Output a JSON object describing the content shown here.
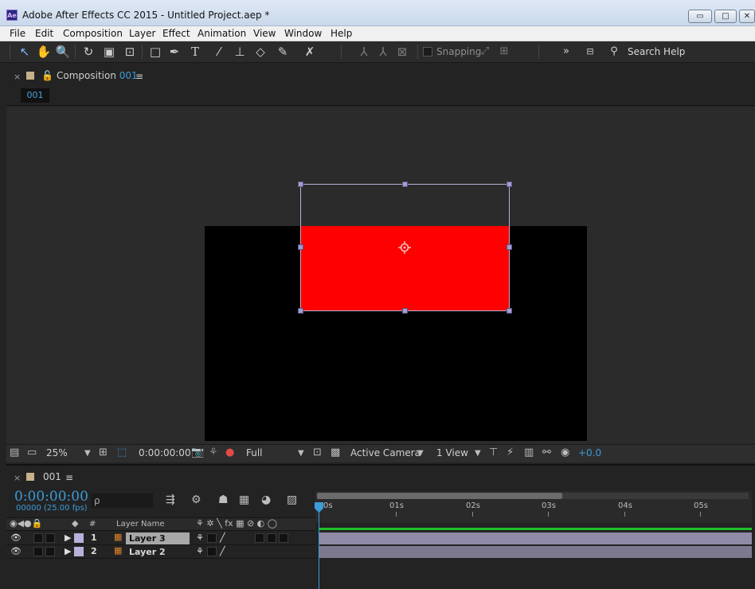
{
  "window": {
    "app_icon_text": "Ae",
    "title": "Adobe After Effects CC 2015 - Untitled Project.aep *",
    "controls": {
      "minimize": "▭",
      "maximize": "□",
      "close": "✕"
    }
  },
  "menu": [
    "File",
    "Edit",
    "Composition",
    "Layer",
    "Effect",
    "Animation",
    "View",
    "Window",
    "Help"
  ],
  "toolbar": {
    "tools": [
      "selection-icon",
      "hand-icon",
      "zoom-icon",
      "rotate-icon",
      "camera-icon",
      "pan-behind-icon",
      "rectangle-icon",
      "pen-icon",
      "type-icon",
      "brush-icon",
      "clone-stamp-icon",
      "eraser-icon",
      "roto-brush-icon",
      "puppet-pin-icon"
    ],
    "snapping_label": "Snapping",
    "search_label": "Search Help",
    "overflow": "»"
  },
  "composition_panel": {
    "close": "×",
    "title_prefix": "Composition",
    "title_number": "001",
    "menu": "≡",
    "tab": "001",
    "footer": {
      "zoom": "25%",
      "timecode": "0:00:00:00",
      "resolution": "Full",
      "camera": "Active Camera",
      "views": "1 View",
      "exposure": "+0.0"
    }
  },
  "timeline": {
    "close": "×",
    "tab": "001",
    "menu": "≡",
    "timecode": "0:00:00:00",
    "fps": "00000 (25.00 fps)",
    "search_placeholder": "ρ",
    "column_layer_name": "Layer Name",
    "column_hash": "#",
    "ruler_labels": [
      "0s",
      "01s",
      "02s",
      "03s",
      "04s",
      "05s"
    ],
    "layers": [
      {
        "index": "1",
        "name": "Layer 3",
        "selected": true
      },
      {
        "index": "2",
        "name": "Layer 2",
        "selected": false
      }
    ]
  },
  "colors": {
    "accent": "#3c9bd8",
    "red_solid": "#ff0000",
    "label_lavender": "#b7b1dc",
    "comp_swatch": "#c8b08a"
  }
}
